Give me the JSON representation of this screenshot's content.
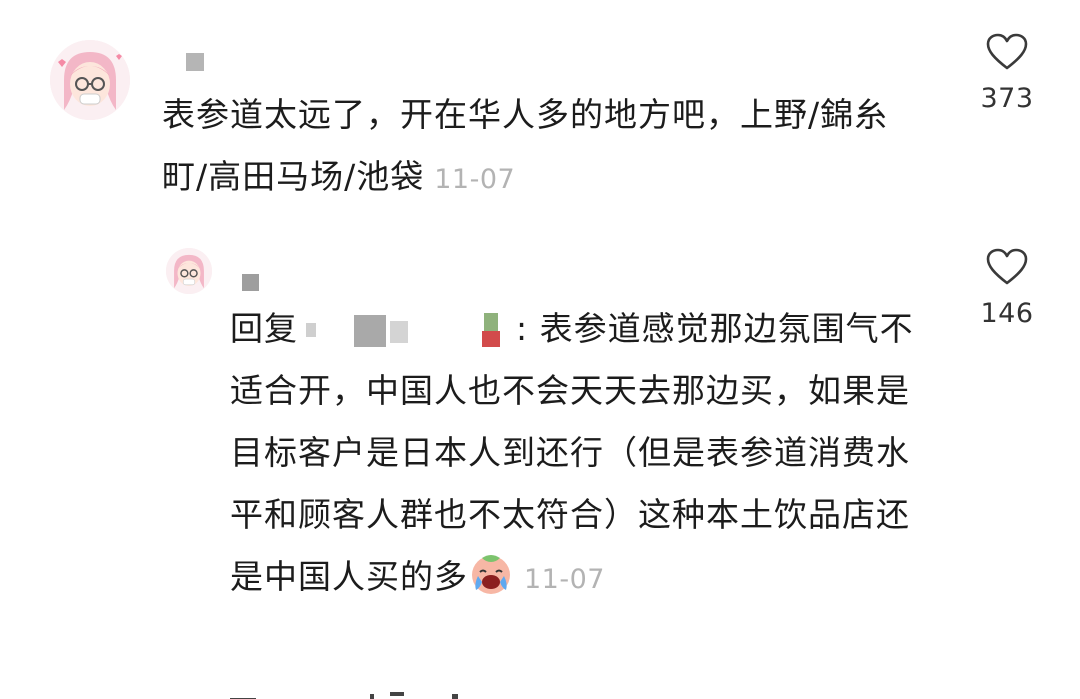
{
  "comments": [
    {
      "text": "表参道太远了，开在华人多的地方吧，上野/錦糸町/高田马场/池袋",
      "date": "11-07",
      "likes": "373",
      "avatar_icon": "anime-girl-avatar"
    }
  ],
  "reply": {
    "prefix": "回复",
    "text": ": 表参道感觉那边氛围气不适合开，中国人也不会天天去那边买，如果是目标客户是日本人到还行（但是表参道消费水平和顾客人群也不太符合）这种本土饮品店还是中国人买的多",
    "emoji": "crying-face-emoji",
    "date": "11-07",
    "likes": "146",
    "avatar_icon": "anime-girl-avatar"
  },
  "colors": {
    "text": "#1c1c1c",
    "meta": "#b3b3b3",
    "like_icon": "#3a3a3a"
  },
  "icons": {
    "like": "heart-outline-icon"
  }
}
